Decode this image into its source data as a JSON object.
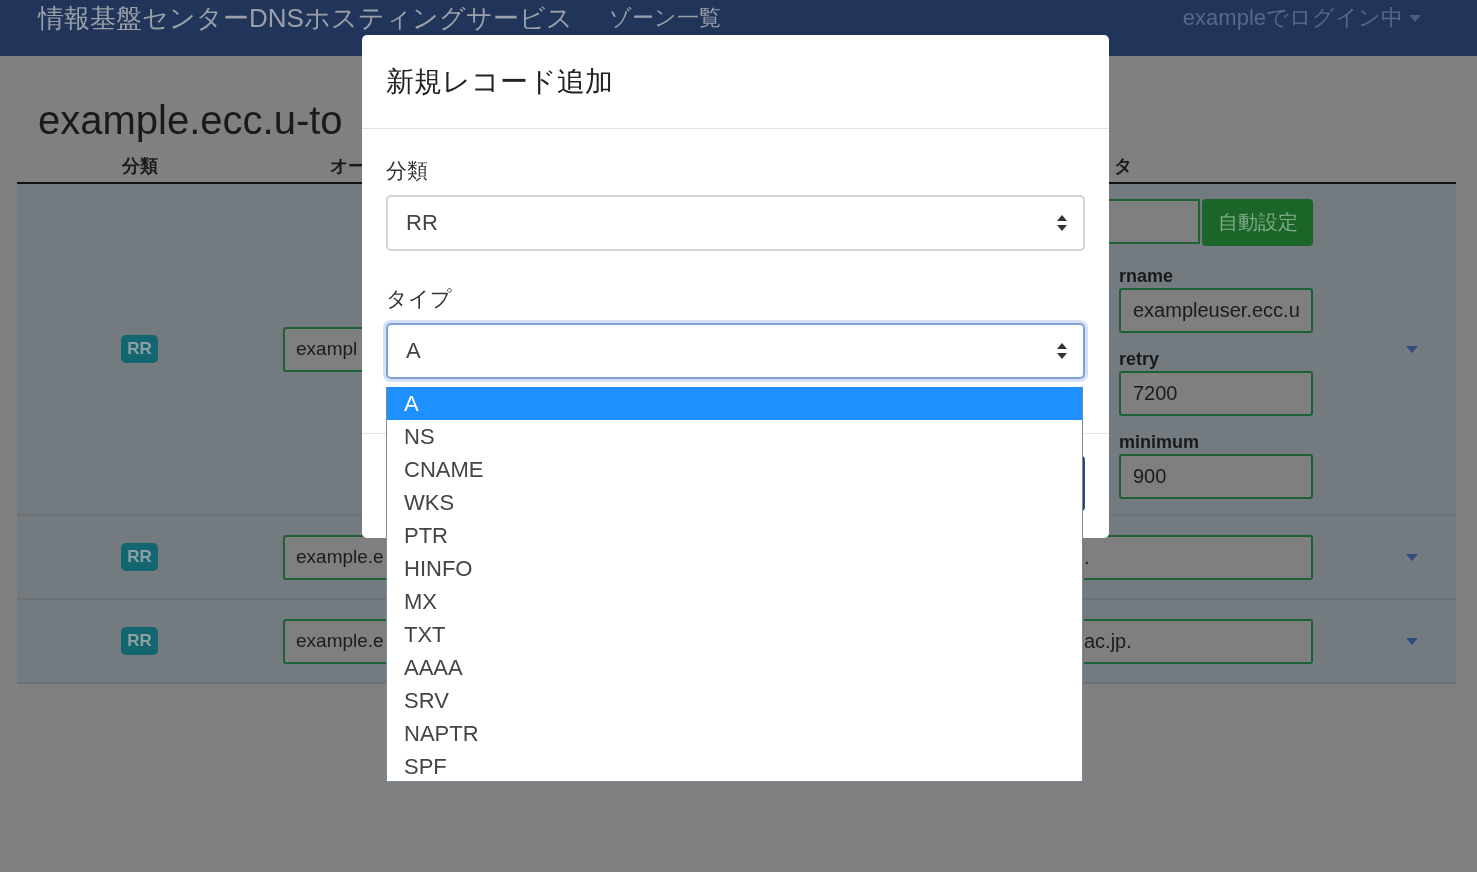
{
  "navbar": {
    "brand": "情報基盤センターDNSホスティングサービス",
    "links": [
      {
        "label": "ゾーン一覧"
      }
    ],
    "user_menu": "exampleでログイン中"
  },
  "zone": {
    "title": "example.ecc.u-to",
    "columns": [
      "分類",
      "オー",
      "タ"
    ],
    "records": [
      {
        "class": "RR",
        "owner": "exampl",
        "fields": [
          {
            "kind": "with-button",
            "button": "自動設定"
          },
          {
            "kind": "labeled",
            "label": "rname",
            "value": "exampleuser.ecc.u"
          },
          {
            "kind": "labeled",
            "label": "retry",
            "value": "7200"
          },
          {
            "kind": "labeled",
            "label": "minimum",
            "value": "900"
          }
        ]
      },
      {
        "class": "RR",
        "owner": "example.e",
        "fields": [
          {
            "kind": "plain",
            "value": "."
          }
        ]
      },
      {
        "class": "RR",
        "owner": "example.e",
        "fields": [
          {
            "kind": "plain",
            "value": "ac.jp."
          }
        ]
      }
    ]
  },
  "modal": {
    "title": "新規レコード追加",
    "fields": [
      {
        "label": "分類",
        "value": "RR",
        "focused": false
      },
      {
        "label": "タイプ",
        "value": "A",
        "focused": true
      }
    ],
    "dropdown": {
      "options": [
        {
          "label": "A",
          "selected": true
        },
        {
          "label": "NS",
          "selected": false
        },
        {
          "label": "CNAME",
          "selected": false
        },
        {
          "label": "WKS",
          "selected": false
        },
        {
          "label": "PTR",
          "selected": false
        },
        {
          "label": "HINFO",
          "selected": false
        },
        {
          "label": "MX",
          "selected": false
        },
        {
          "label": "TXT",
          "selected": false
        },
        {
          "label": "AAAA",
          "selected": false
        },
        {
          "label": "SRV",
          "selected": false
        },
        {
          "label": "NAPTR",
          "selected": false
        },
        {
          "label": "SPF",
          "selected": false
        }
      ]
    }
  }
}
